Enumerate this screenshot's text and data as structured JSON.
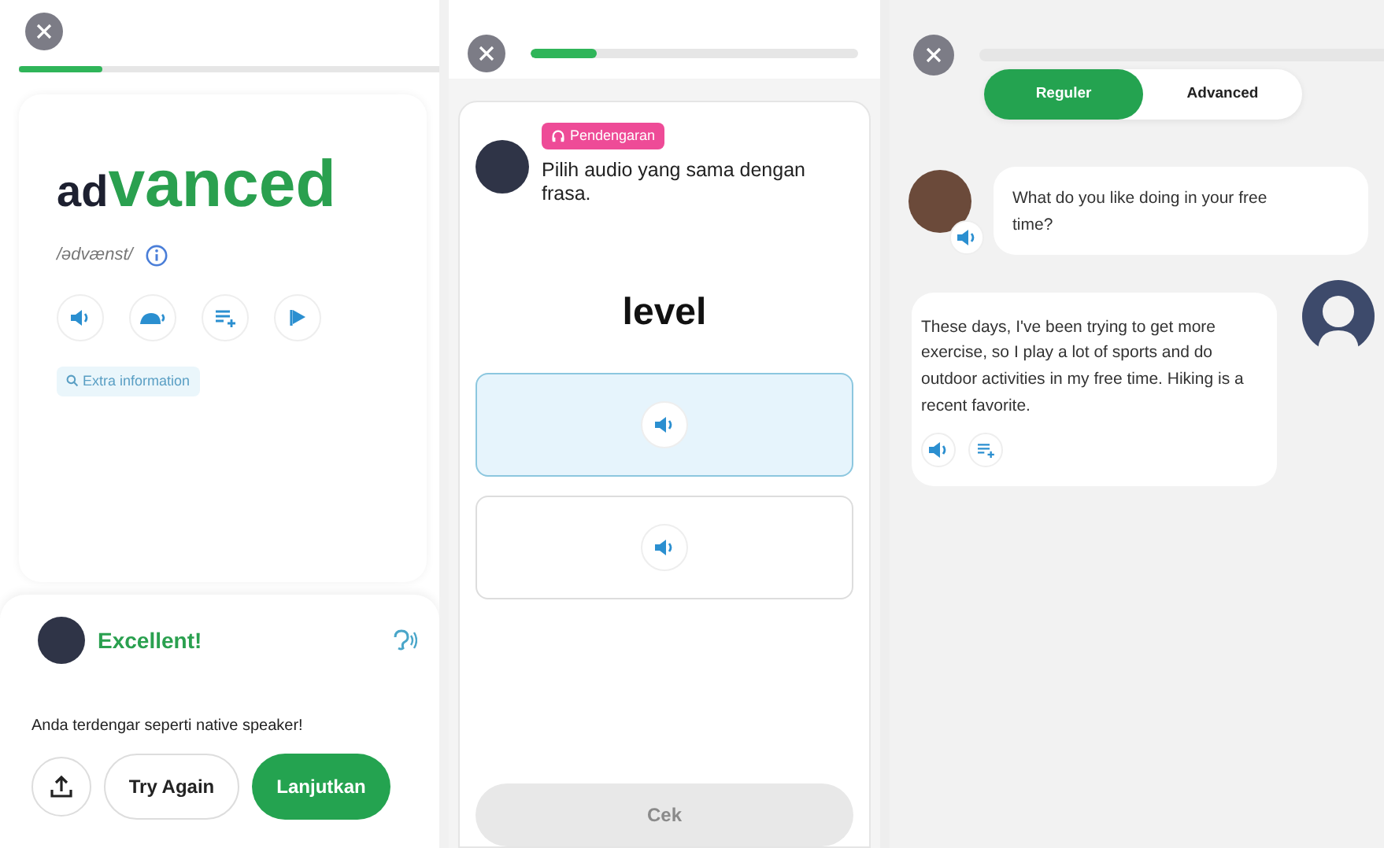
{
  "screens": [
    {
      "kind": "word",
      "level": 0.2,
      "word_prefix": "ad",
      "word_focus": "vanced",
      "pronunciation": "/ədvænst/",
      "extra_info": "Extra information",
      "feedback_title": "Excellent!",
      "feedback_message": "Anda terdengar seperti native speaker!",
      "secondary_button": "Try Again",
      "primary_button": "Lanjutkan"
    },
    {
      "kind": "quiz",
      "level": 0.2,
      "badge": "Pendengaran",
      "prompt": "Pilih audio yang sama dengan frasa.",
      "word": "level",
      "options": [
        {
          "selected": true
        },
        {
          "selected": false
        }
      ],
      "check_button": {
        "label": "Cek",
        "disabled": true
      }
    },
    {
      "kind": "chat",
      "level": 0,
      "modes": [
        {
          "label": "Reguler",
          "selected": true
        },
        {
          "label": "Advanced",
          "selected": false
        }
      ],
      "messages": [
        {
          "kind": "bot",
          "text": "What do you like doing in your free time?"
        },
        {
          "kind": "user",
          "text": "These days, I've been trying to get more exercise, so I play a lot of sports and do outdoor activities in my free time. Hiking is a recent favorite."
        }
      ]
    }
  ]
}
